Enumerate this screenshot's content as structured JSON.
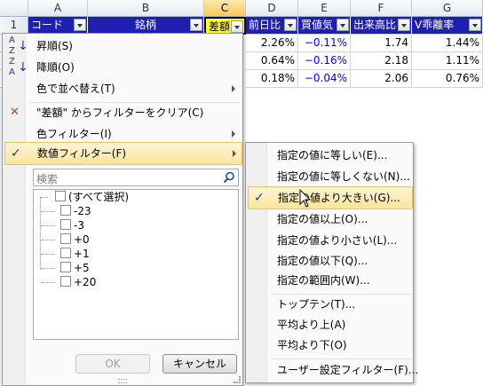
{
  "columns": [
    "A",
    "B",
    "C",
    "D",
    "E",
    "F",
    "G"
  ],
  "rows": [
    "1",
    "2",
    "3",
    "4"
  ],
  "header_cells": [
    "コード",
    "銘柄",
    "差額",
    "前日比",
    "買値気",
    "出来高比",
    "V乖離率"
  ],
  "data_rows": [
    [
      "2.26%",
      "−0.11%",
      "1.74",
      "1.44%"
    ],
    [
      "0.64%",
      "−0.16%",
      "2.18",
      "1.11%"
    ],
    [
      "0.18%",
      "−0.04%",
      "2.06",
      "0.76%"
    ]
  ],
  "menu": {
    "sort_asc": "昇順(S)",
    "sort_desc": "降順(O)",
    "sort_color": "色で並べ替え(T)",
    "clear_filter": "\"差額\" からフィルターをクリア(C)",
    "color_filter": "色フィルター(I)",
    "number_filter": "数値フィルター(F)",
    "search_placeholder": "検索",
    "values": [
      "(すべて選択)",
      "-23",
      "-3",
      "+0",
      "+1",
      "+5",
      "+20"
    ],
    "ok": "OK",
    "cancel": "キャンセル"
  },
  "submenu": {
    "items": [
      "指定の値に等しい(E)...",
      "指定の値に等しくない(N)...",
      "指定の値より大きい(G)...",
      "指定の値以上(O)...",
      "指定の値より小さい(L)...",
      "指定の値以下(Q)...",
      "指定の範囲内(W)..."
    ],
    "items2": [
      "トップテン(T)...",
      "平均より上(A)",
      "平均より下(O)"
    ],
    "custom": "ユーザー設定フィルター(F)..."
  },
  "colors": {
    "header_blue": "#1f1fb0",
    "header_yellow": "#ffff33",
    "highlight": "#fbe59a",
    "negative": "#0000ff"
  }
}
